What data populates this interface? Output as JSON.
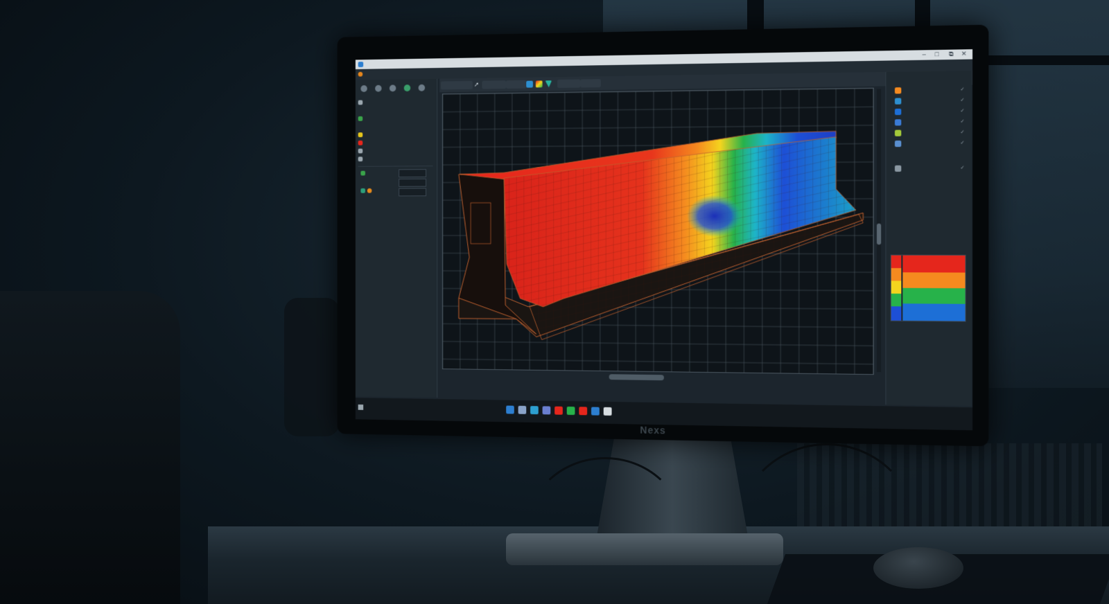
{
  "colors": {
    "accent": "#2d7fd0",
    "stress_high": "#e5261c",
    "stress_mid_high": "#f58a1f",
    "stress_mid": "#f4d41e",
    "stress_mid_low": "#27b24a",
    "stress_low": "#1d4fd6",
    "mesh_wire": "#c0612f",
    "grid_line": "#4a5660"
  },
  "monitor": {
    "brand": "Nexs"
  },
  "window": {
    "title": "",
    "controls": [
      "–",
      "□",
      "⧉",
      "✕"
    ]
  },
  "menubar": {
    "items": [
      "",
      "",
      "",
      ""
    ]
  },
  "toolbar": {
    "buttons": [
      "",
      "",
      ""
    ],
    "icons": [
      "pointer-icon",
      "cube-icon",
      "palette-icon",
      "filter-icon",
      "dropdown-icon"
    ]
  },
  "left_panel": {
    "icons": [
      "house-icon",
      "rotate-icon",
      "sphere-icon",
      "shield-icon",
      "gear-icon"
    ],
    "tree": [
      {
        "color": "#9aa6ae",
        "label": "",
        "value": ""
      },
      {
        "color": "#3aa34a",
        "label": "",
        "value": ""
      },
      {
        "color": "#e5c51c",
        "label": "",
        "value": ""
      },
      {
        "color": "#e5261c",
        "label": "",
        "value": ""
      },
      {
        "color": "#9aa6ae",
        "label": "",
        "value": ""
      }
    ]
  },
  "right_panel": {
    "header": "",
    "layers": [
      {
        "color": "#f58a1f",
        "label": ""
      },
      {
        "color": "#2d8fd0",
        "label": ""
      },
      {
        "color": "#1d6fd6",
        "label": ""
      },
      {
        "color": "#3a7bd5",
        "label": ""
      },
      {
        "color": "#a3c93a",
        "label": ""
      },
      {
        "color": "#5a8fd0",
        "label": ""
      }
    ],
    "section2_header": "",
    "legend_title": "",
    "legend_labels": [
      "",
      "",
      ""
    ]
  },
  "taskbar": {
    "items": [
      "",
      "",
      "",
      ""
    ],
    "icons": [
      "file-icon",
      "pen-icon",
      "folder-icon",
      "user-icon",
      "chart-icon",
      "camera-icon",
      "shield-icon",
      "app-icon",
      "snapshot-icon"
    ],
    "tray_line1": "",
    "tray_line2": ""
  }
}
